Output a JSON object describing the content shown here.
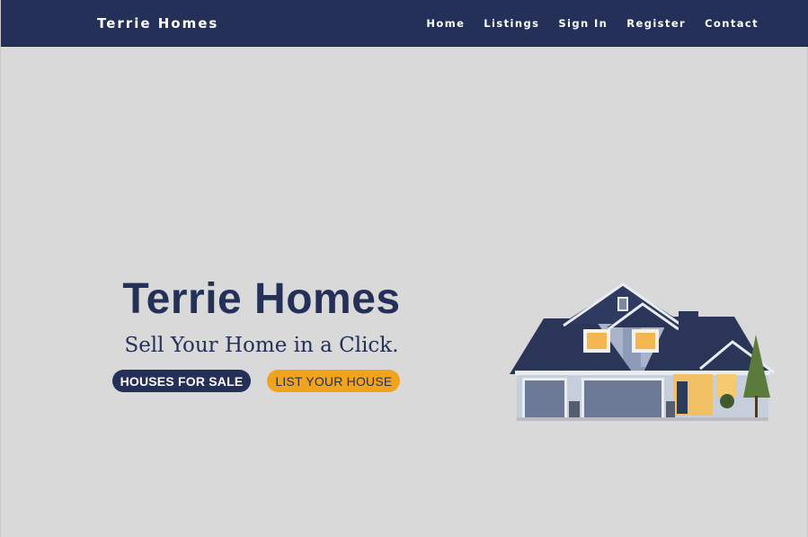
{
  "navbar": {
    "brand": "Terrie Homes",
    "links": [
      "Home",
      "Listings",
      "Sign In",
      "Register",
      "Contact"
    ]
  },
  "hero": {
    "title": "Terrie Homes",
    "subtitle": "Sell Your Home in a Click.",
    "buttons": {
      "houses_for_sale": "HOUSES FOR SALE",
      "list_your_house": "LIST YOUR HOUSE"
    },
    "image": "house-photo"
  },
  "colors": {
    "navy": "#243057",
    "accent_orange": "#f0a31b",
    "background": "#d9d9d9"
  }
}
